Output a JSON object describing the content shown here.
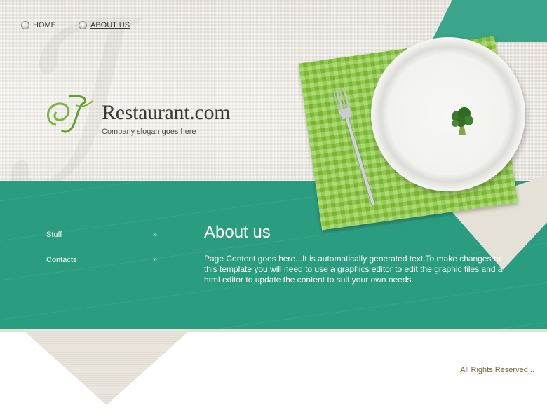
{
  "nav": {
    "items": [
      {
        "label": "HOME",
        "active": false
      },
      {
        "label": "ABOUT US",
        "active": true
      }
    ]
  },
  "brand": {
    "name": "Restaurant.com",
    "slogan": "Company slogan goes here",
    "logo_icon": "monogram-icon"
  },
  "sidebar": {
    "items": [
      {
        "label": "Stuff",
        "arrow": "»"
      },
      {
        "label": "Contacts",
        "arrow": "»"
      }
    ]
  },
  "content": {
    "title": "About us",
    "body": "Page Content goes here...It is automatically generated text.To make changes to this template you will need to use a graphics editor to edit the graphic files and a html editor to update the content to suit your own needs."
  },
  "footer": {
    "text": "All Rights Reserved..."
  },
  "colors": {
    "teal": "#2a9c80",
    "linen": "#ece8e1",
    "placemat_green": "#8ccd3c",
    "footer_text": "#6e6a3c"
  }
}
